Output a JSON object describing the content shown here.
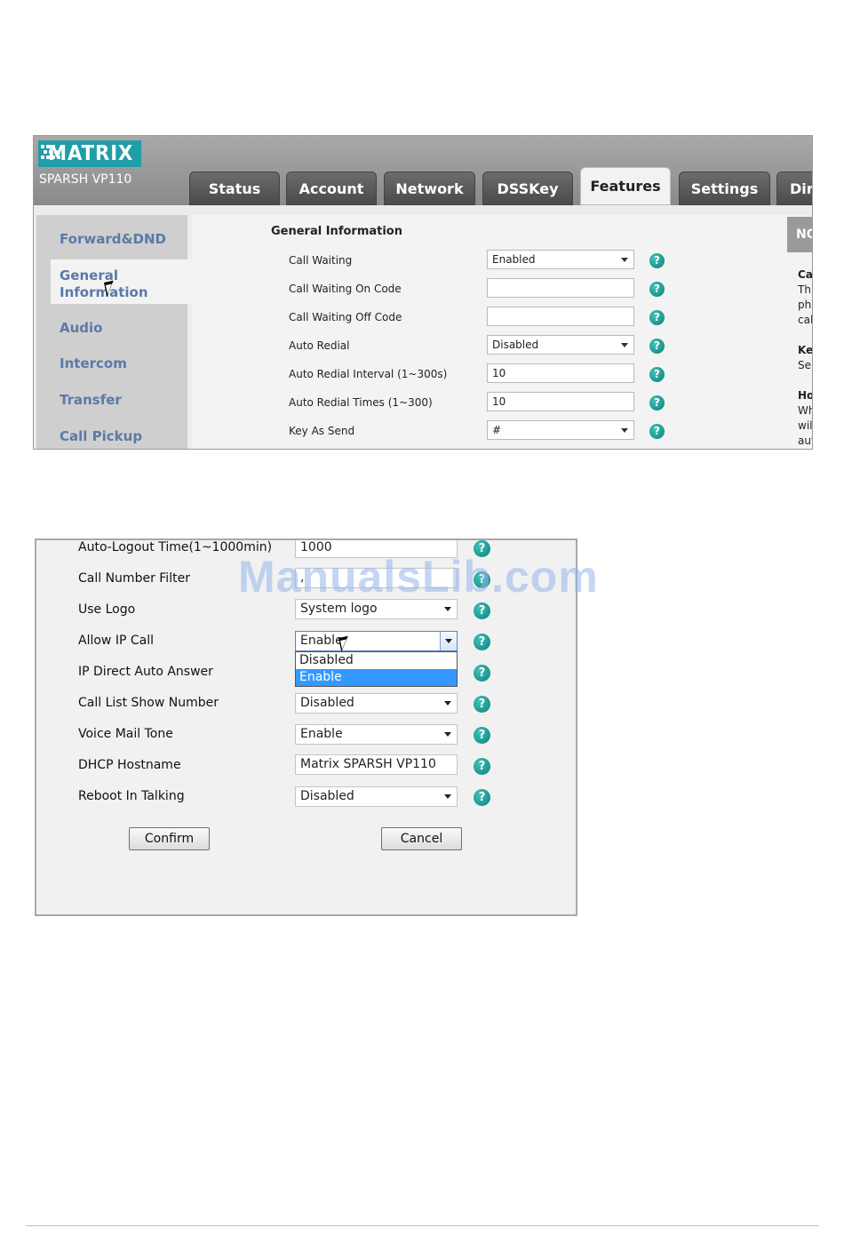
{
  "screenshot1": {
    "brand": "MATRIX",
    "model": "SPARSH VP110",
    "tabs": [
      {
        "label": "Status",
        "active": false
      },
      {
        "label": "Account",
        "active": false
      },
      {
        "label": "Network",
        "active": false
      },
      {
        "label": "DSSKey",
        "active": false
      },
      {
        "label": "Features",
        "active": true
      },
      {
        "label": "Settings",
        "active": false
      },
      {
        "label": "Dir",
        "active": false
      }
    ],
    "sidebar": [
      {
        "label": "Forward&DND"
      },
      {
        "label": "General Information",
        "line1": "General",
        "line2": "Information",
        "selected": true
      },
      {
        "label": "Audio"
      },
      {
        "label": "Intercom"
      },
      {
        "label": "Transfer"
      },
      {
        "label": "Call Pickup"
      }
    ],
    "section_title": "General Information",
    "fields": [
      {
        "label": "Call Waiting",
        "value": "Enabled",
        "type": "select"
      },
      {
        "label": "Call Waiting On Code",
        "value": "",
        "type": "text"
      },
      {
        "label": "Call Waiting Off Code",
        "value": "",
        "type": "text"
      },
      {
        "label": "Auto Redial",
        "value": "Disabled",
        "type": "select"
      },
      {
        "label": "Auto Redial Interval (1~300s)",
        "value": "10",
        "type": "text"
      },
      {
        "label": "Auto Redial Times (1~300)",
        "value": "10",
        "type": "text"
      },
      {
        "label": "Key As Send",
        "value": "#",
        "type": "select"
      }
    ],
    "note": {
      "head": "NO",
      "lines": [
        "Cal",
        "Thi",
        "pho",
        "cal",
        "Key",
        "Sel",
        "Ho",
        "Wh",
        "wil",
        "aut"
      ]
    },
    "help_glyph": "?"
  },
  "screenshot2": {
    "fields": [
      {
        "label": "Auto-Logout Time(1~1000min)",
        "value": "1000",
        "type": "text"
      },
      {
        "label": "Call Number Filter",
        "value": ",",
        "type": "text"
      },
      {
        "label": "Use Logo",
        "value": "System logo",
        "type": "select"
      },
      {
        "label": "Allow IP Call",
        "value": "Enable",
        "type": "select-open"
      },
      {
        "label": "IP Direct Auto Answer",
        "value": "",
        "type": "hidden"
      },
      {
        "label": "Call List Show Number",
        "value": "Disabled",
        "type": "select"
      },
      {
        "label": "Voice Mail Tone",
        "value": "Enable",
        "type": "select"
      },
      {
        "label": "DHCP Hostname",
        "value": "Matrix SPARSH VP110",
        "type": "text"
      },
      {
        "label": "Reboot In Talking",
        "value": "Disabled",
        "type": "select"
      }
    ],
    "dropdown_options": [
      "Disabled",
      "Enable"
    ],
    "dropdown_highlighted": "Enable",
    "buttons": {
      "confirm": "Confirm",
      "cancel": "Cancel"
    }
  },
  "watermark": "ManualsLib.com",
  "colors": {
    "brand": "#1f9ea8",
    "help": "#0c7f7a",
    "sidebar_text": "#5b79a8",
    "highlight": "#3399ff"
  }
}
